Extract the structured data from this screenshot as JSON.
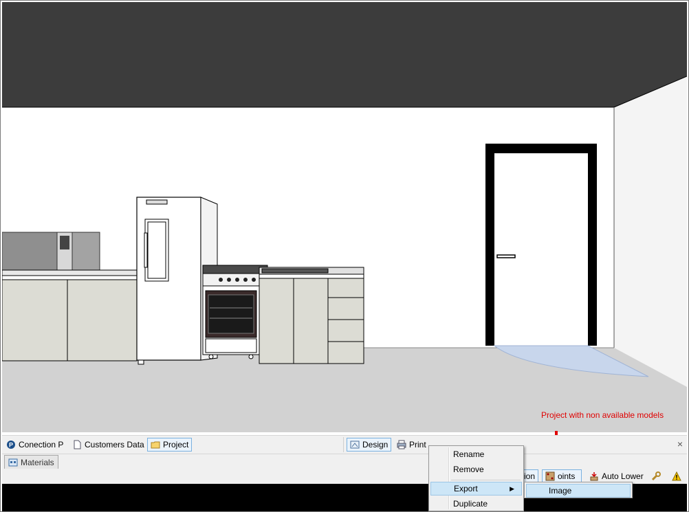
{
  "annotation": {
    "text": "Project with non available models",
    "color": "#e00000"
  },
  "bottom_tabs": {
    "left": [
      {
        "label": "Conection P",
        "icon": "connection-icon"
      },
      {
        "label": "Customers Data",
        "icon": "document-icon"
      },
      {
        "label": "Project",
        "icon": "folder-icon",
        "active": true
      }
    ],
    "right": [
      {
        "label": "Design",
        "icon": "design-icon",
        "active": true
      },
      {
        "label": "Print",
        "icon": "print-icon"
      }
    ],
    "close": "×"
  },
  "panel_tab": {
    "label": "Materials",
    "icon": "materials-icon"
  },
  "toolbar": {
    "partial_a": "ion",
    "points_label": "oints",
    "auto_lower_label": "Auto Lower",
    "icons": [
      "points-icon",
      "auto-lower-icon",
      "wrench-icon",
      "warning-icon"
    ]
  },
  "context_menu": {
    "items": [
      {
        "label": "Rename"
      },
      {
        "label": "Remove"
      },
      {
        "label": "Export",
        "submenu": true,
        "highlighted": true
      },
      {
        "label": "Duplicate"
      }
    ],
    "submenu_arrow": "▶",
    "export_submenu": [
      {
        "label": "Image",
        "highlighted": true
      }
    ]
  },
  "colors": {
    "ceiling": "#3c3c3c",
    "floor": "#d2d2d2",
    "cabinet": "#dcdcd4",
    "accent_border": "#7ab1e0",
    "menu_highlight": "#cde6f7"
  }
}
